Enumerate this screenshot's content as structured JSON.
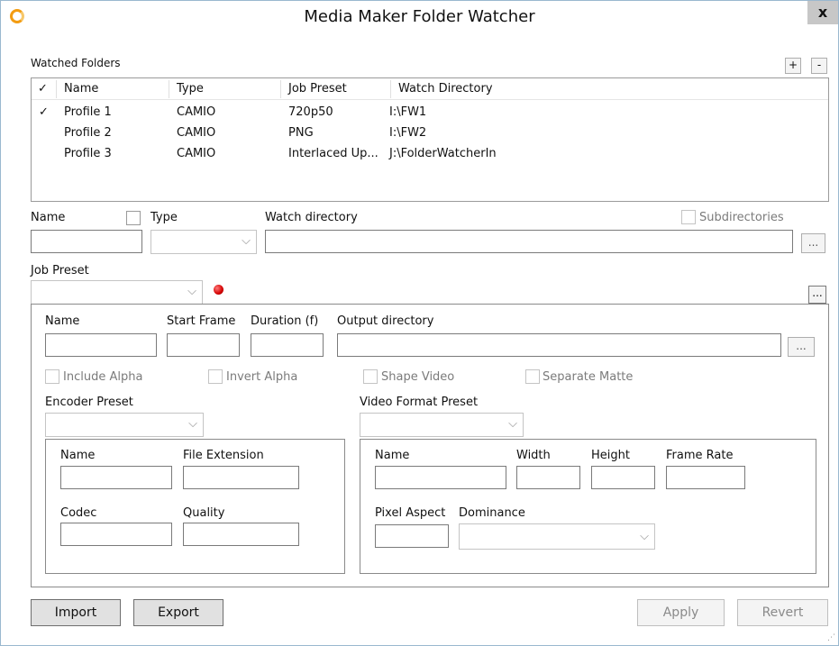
{
  "window": {
    "title": "Media Maker Folder Watcher",
    "close_label": "x"
  },
  "watched_folders": {
    "label": "Watched Folders",
    "add_label": "+",
    "remove_label": "-",
    "columns": {
      "check": "✓",
      "name": "Name",
      "type": "Type",
      "job_preset": "Job Preset",
      "watch_directory": "Watch Directory"
    },
    "rows": [
      {
        "checked": "✓",
        "name": "Profile 1",
        "type": "CAMIO",
        "job_preset": "720p50",
        "watch_directory": "I:\\FW1"
      },
      {
        "checked": "",
        "name": "Profile 2",
        "type": "CAMIO",
        "job_preset": "PNG",
        "watch_directory": "I:\\FW2"
      },
      {
        "checked": "",
        "name": "Profile 3",
        "type": "CAMIO",
        "job_preset": "Interlaced Up...",
        "watch_directory": "J:\\FolderWatcherIn"
      }
    ]
  },
  "profile": {
    "name_label": "Name",
    "type_label": "Type",
    "watch_directory_label": "Watch directory",
    "subdirectories_label": "Subdirectories",
    "browse_label": "...",
    "job_preset_label": "Job Preset",
    "job_preset_browse_label": "..."
  },
  "job_preset": {
    "name_label": "Name",
    "start_frame_label": "Start Frame",
    "duration_label": "Duration (f)",
    "output_directory_label": "Output directory",
    "browse_label": "...",
    "include_alpha_label": "Include Alpha",
    "invert_alpha_label": "Invert Alpha",
    "shape_video_label": "Shape Video",
    "separate_matte_label": "Separate Matte",
    "encoder_preset_label": "Encoder Preset",
    "video_format_preset_label": "Video Format Preset"
  },
  "encoder": {
    "name_label": "Name",
    "file_extension_label": "File Extension",
    "codec_label": "Codec",
    "quality_label": "Quality"
  },
  "video_format": {
    "name_label": "Name",
    "width_label": "Width",
    "height_label": "Height",
    "frame_rate_label": "Frame Rate",
    "pixel_aspect_label": "Pixel Aspect",
    "dominance_label": "Dominance"
  },
  "buttons": {
    "import": "Import",
    "export": "Export",
    "apply": "Apply",
    "revert": "Revert"
  },
  "icons": {
    "app": "app-logo-icon",
    "dropdown": "chevron-down-icon",
    "status": "red-status-dot-icon"
  },
  "colors": {
    "accent_orange": "#f39c12",
    "status_red": "#d40000",
    "window_border": "#9ab8cf"
  }
}
